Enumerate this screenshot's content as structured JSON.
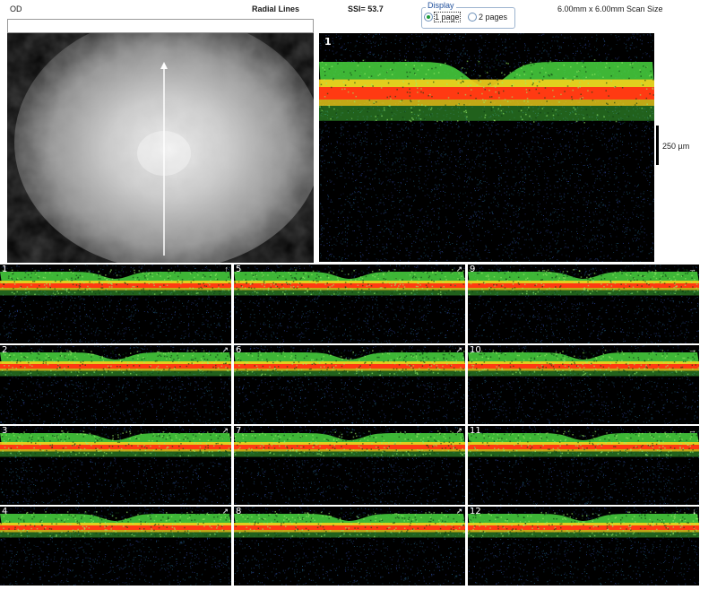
{
  "header": {
    "eye": "OD",
    "scan_type": "Radial Lines",
    "ssi": "SSI= 53.7",
    "scan_size": "6.00mm x 6.00mm Scan Size"
  },
  "display": {
    "legend": "Display",
    "options": [
      {
        "label": "1 page",
        "selected": true
      },
      {
        "label": "2 pages",
        "selected": false
      }
    ]
  },
  "main_scan": {
    "number": "1",
    "scale_label": "250 µm"
  },
  "tiles": [
    {
      "number": "1",
      "dir": "↑"
    },
    {
      "number": "2",
      "dir": "↗"
    },
    {
      "number": "3",
      "dir": "↗"
    },
    {
      "number": "4",
      "dir": "↗"
    },
    {
      "number": "5",
      "dir": "↗"
    },
    {
      "number": "6",
      "dir": "↗"
    },
    {
      "number": "7",
      "dir": "↗"
    },
    {
      "number": "8",
      "dir": "↗"
    },
    {
      "number": "9",
      "dir": "→"
    },
    {
      "number": "10",
      "dir": "→"
    },
    {
      "number": "11",
      "dir": "→"
    },
    {
      "number": "12",
      "dir": "↓"
    }
  ],
  "colors": {
    "rpe": "#ff3a12",
    "retina": "#49d63f",
    "noise": "#2a3f8f",
    "background": "#000000"
  }
}
